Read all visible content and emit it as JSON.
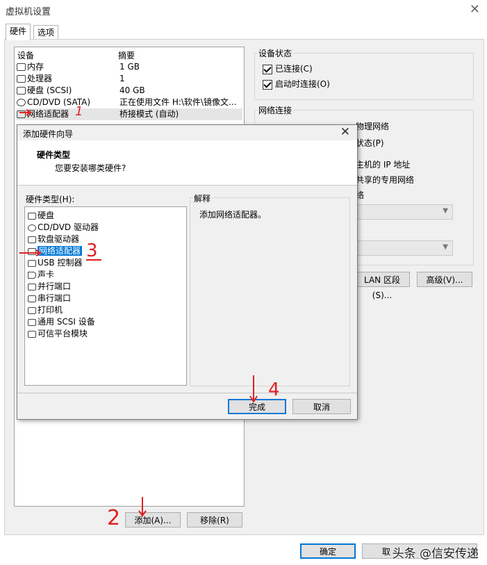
{
  "window": {
    "title": "虚拟机设置",
    "close_icon": "✕"
  },
  "tabs": [
    {
      "label": "硬件"
    },
    {
      "label": "选项"
    }
  ],
  "device_list": {
    "header_device": "设备",
    "header_summary": "摘要",
    "rows": [
      {
        "icon": "memory-icon",
        "name": "内存",
        "summary": "1 GB"
      },
      {
        "icon": "cpu-icon",
        "name": "处理器",
        "summary": "1"
      },
      {
        "icon": "harddisk-icon",
        "name": "硬盘 (SCSI)",
        "summary": "40 GB"
      },
      {
        "icon": "cd-icon",
        "name": "CD/DVD (SATA)",
        "summary": "正在使用文件 H:\\软件\\镜像文..."
      },
      {
        "icon": "network-icon",
        "name": "网络适配器",
        "summary": "桥接模式 (自动)"
      }
    ]
  },
  "device_status": {
    "title": "设备状态",
    "connected": "已连接(C)",
    "connect_at_power_on": "启动时连接(O)"
  },
  "network_connection": {
    "title": "网络连接",
    "partial_texts": [
      "物理网络",
      "状态(P)",
      "主机的 IP 地址",
      "共享的专用网络",
      "络"
    ]
  },
  "buttons": {
    "lan_segments": "LAN 区段(S)...",
    "advanced": "高级(V)...",
    "add": "添加(A)...",
    "remove": "移除(R)",
    "ok": "确定",
    "cancel_partial": "取"
  },
  "wizard": {
    "title": "添加硬件向导",
    "heading": "硬件类型",
    "subheading": "您要安装哪类硬件?",
    "list_label": "硬件类型(H):",
    "items": [
      {
        "icon": "harddisk-icon",
        "label": "硬盘"
      },
      {
        "icon": "cd-icon",
        "label": "CD/DVD 驱动器"
      },
      {
        "icon": "floppy-icon",
        "label": "软盘驱动器"
      },
      {
        "icon": "network-icon",
        "label": "网络适配器"
      },
      {
        "icon": "usb-icon",
        "label": "USB 控制器"
      },
      {
        "icon": "sound-icon",
        "label": "声卡"
      },
      {
        "icon": "parallel-port-icon",
        "label": "并行端口"
      },
      {
        "icon": "serial-port-icon",
        "label": "串行端口"
      },
      {
        "icon": "printer-icon",
        "label": "打印机"
      },
      {
        "icon": "scsi-icon",
        "label": "通用 SCSI 设备"
      },
      {
        "icon": "tpm-icon",
        "label": "可信平台模块"
      }
    ],
    "explanation_title": "解释",
    "explanation_text": "添加网络适配器。",
    "finish": "完成",
    "cancel": "取消"
  },
  "annotations": {
    "n1": "1",
    "n2": "2",
    "n3": "3",
    "n4": "4"
  },
  "watermark": "头条 @信安传递",
  "colors": {
    "selection": "#0078d7",
    "annotation": "#e02020"
  }
}
